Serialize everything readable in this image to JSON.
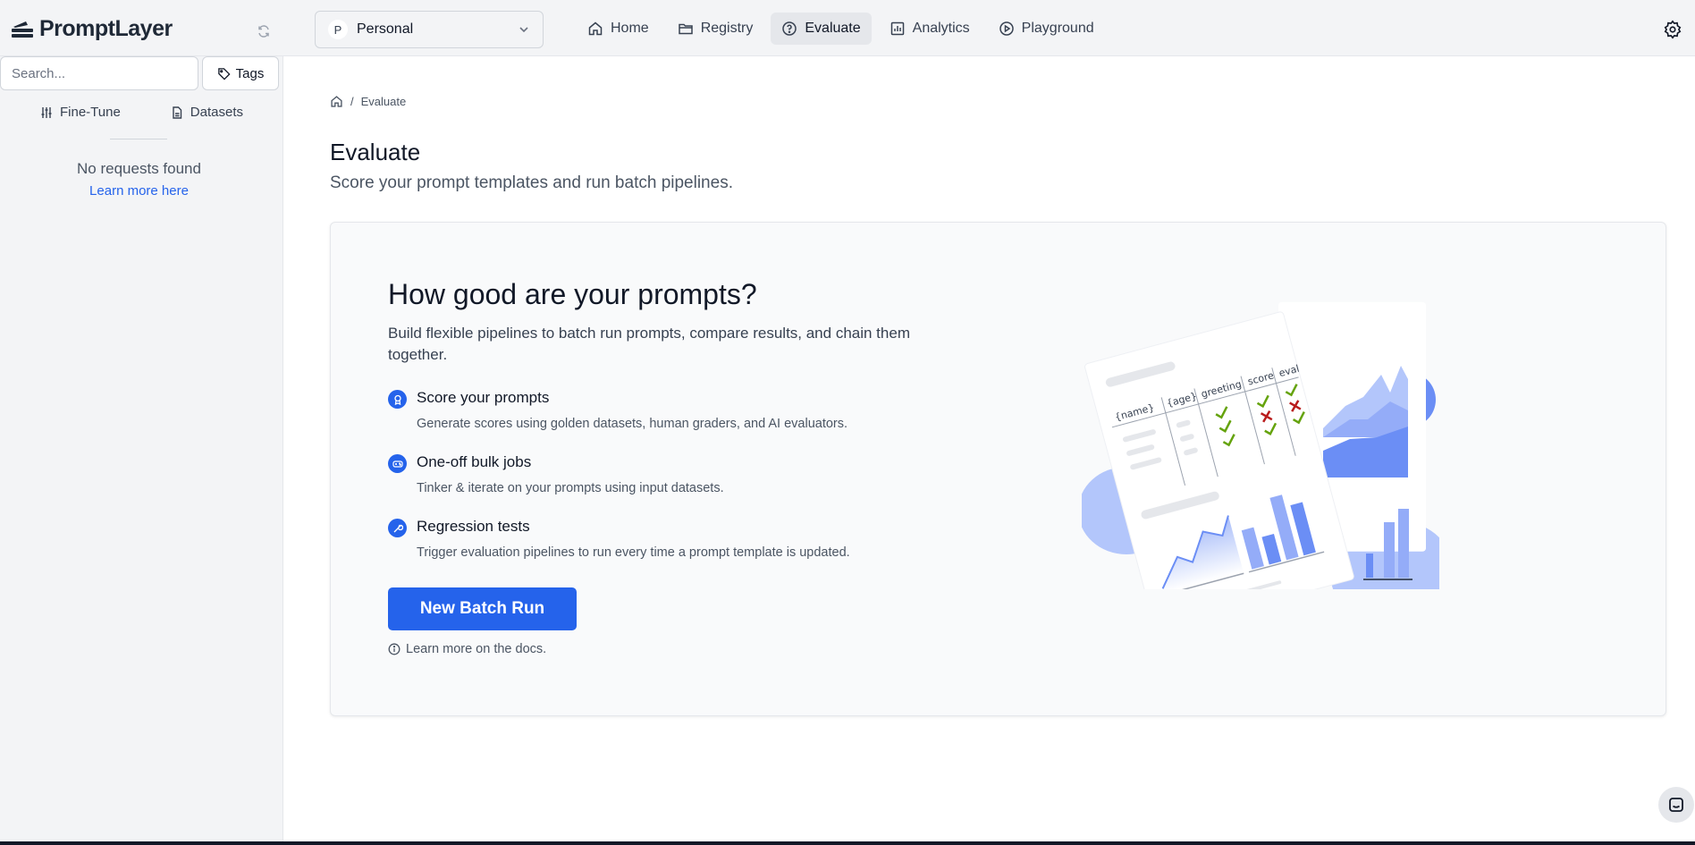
{
  "app": {
    "name": "PromptLayer"
  },
  "workspace": {
    "initial": "P",
    "name": "Personal"
  },
  "nav": {
    "items": [
      {
        "label": "Home",
        "icon": "home-icon"
      },
      {
        "label": "Registry",
        "icon": "folder-icon"
      },
      {
        "label": "Evaluate",
        "icon": "help-circle-icon",
        "active": true
      },
      {
        "label": "Analytics",
        "icon": "bar-chart-icon"
      },
      {
        "label": "Playground",
        "icon": "play-circle-icon"
      }
    ]
  },
  "sidebar": {
    "search_placeholder": "Search...",
    "tags_label": "Tags",
    "tabs": [
      {
        "label": "Fine-Tune",
        "icon": "sliders-icon"
      },
      {
        "label": "Datasets",
        "icon": "file-icon"
      }
    ],
    "empty_message": "No requests found",
    "learn_more": "Learn more here"
  },
  "breadcrumb": {
    "current": "Evaluate"
  },
  "page": {
    "title": "Evaluate",
    "subtitle": "Score your prompt templates and run batch pipelines."
  },
  "card": {
    "title": "How good are your prompts?",
    "description": "Build flexible pipelines to batch run prompts, compare results, and chain them together.",
    "features": [
      {
        "title": "Score your prompts",
        "description": "Generate scores using golden datasets, human graders, and AI evaluators.",
        "icon": "award-icon"
      },
      {
        "title": "One-off bulk jobs",
        "description": "Tinker & iterate on your prompts using input datasets.",
        "icon": "gamepad-icon"
      },
      {
        "title": "Regression tests",
        "description": "Trigger evaluation pipelines to run every time a prompt template is updated.",
        "icon": "wrench-icon"
      }
    ],
    "button_label": "New Batch Run",
    "docs_link": "Learn more on the docs.",
    "illustration": {
      "columns": [
        "{name}",
        "{age}",
        "greeting",
        "score",
        "eval"
      ]
    }
  },
  "colors": {
    "accent": "#2563eb",
    "topbar_bg": "#f3f4f6",
    "check": "#65a30d",
    "cross": "#b91c1c",
    "illustration_blue": "#6b8ef5"
  }
}
